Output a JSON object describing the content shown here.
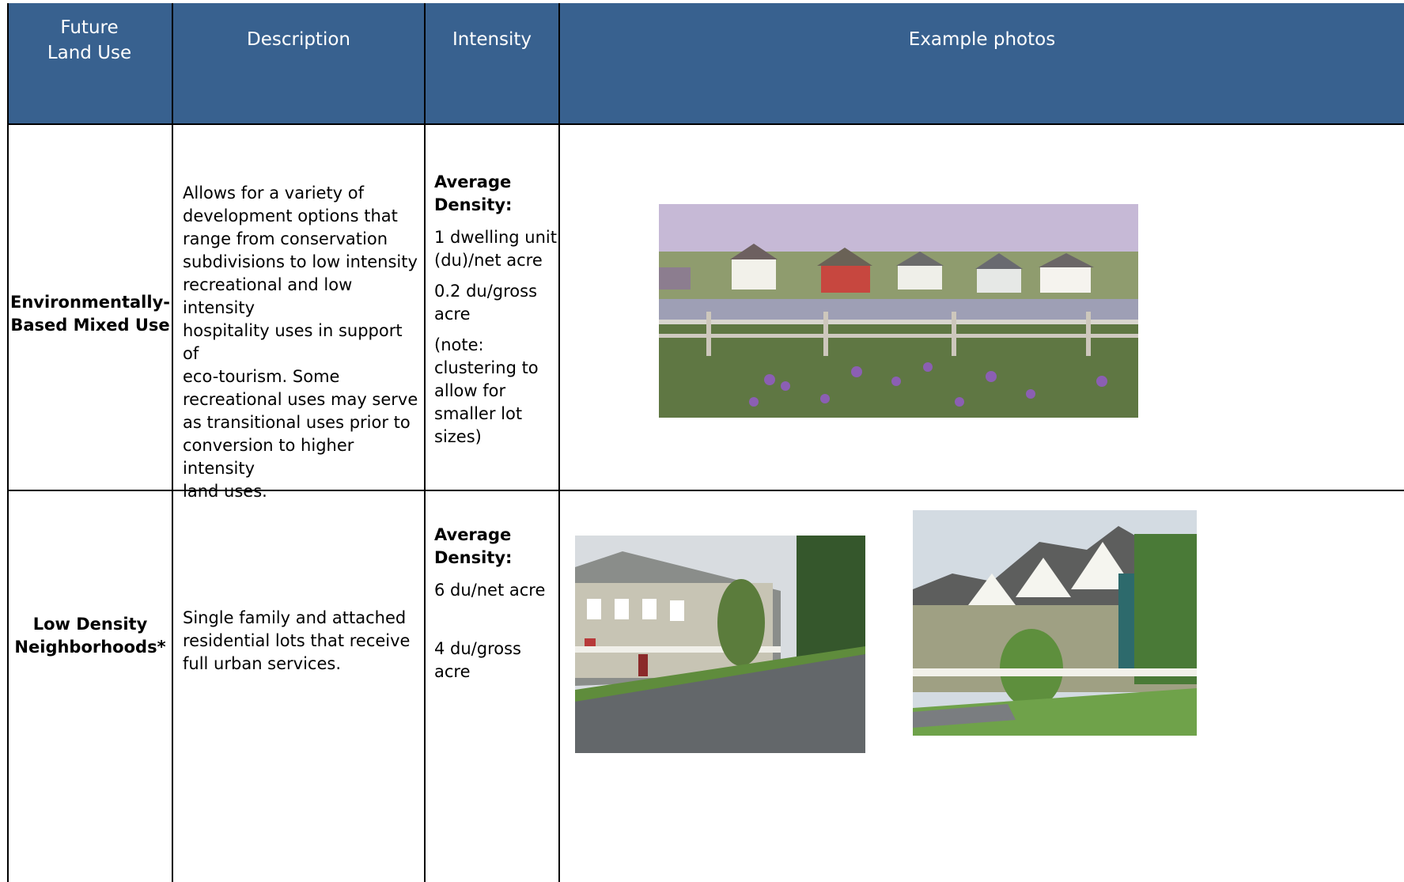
{
  "table": {
    "headers": [
      "Future Land Use",
      "Description",
      "Intensity",
      "Example photos"
    ],
    "rows": [
      {
        "future_land_use": "Environmentally-\nBased Mixed Use",
        "description": "Allows for a variety of\ndevelopment options that\nrange from conservation\nsubdivisions to low intensity\nrecreational and low intensity\nhospitality uses in support of\neco-tourism.  Some\nrecreational uses may serve\nas transitional uses prior to\nconversion to higher intensity\nland uses.",
        "intensity_heading": "Average\nDensity:",
        "intensity_values": [
          "1 dwelling unit\n(du)/net acre",
          "0.2 du/gross\nacre",
          "(note:\nclustering to\nallow for\nsmaller lot\nsizes)"
        ],
        "photos": [
          "houses behind pond and wildflowers"
        ]
      },
      {
        "future_land_use": "Low Density\nNeighborhoods*",
        "description": "Single family and attached\nresidential lots that receive\nfull urban services.",
        "intensity_heading": "Average\nDensity:",
        "intensity_values": [
          "6 du/net acre",
          "4 du/gross\nacre"
        ],
        "photos": [
          "street of porch houses with flags",
          "row of gabled townhomes"
        ]
      }
    ]
  },
  "colors": {
    "header_bg": "#38618f",
    "header_text": "#ffffff",
    "grid": "#000000"
  }
}
